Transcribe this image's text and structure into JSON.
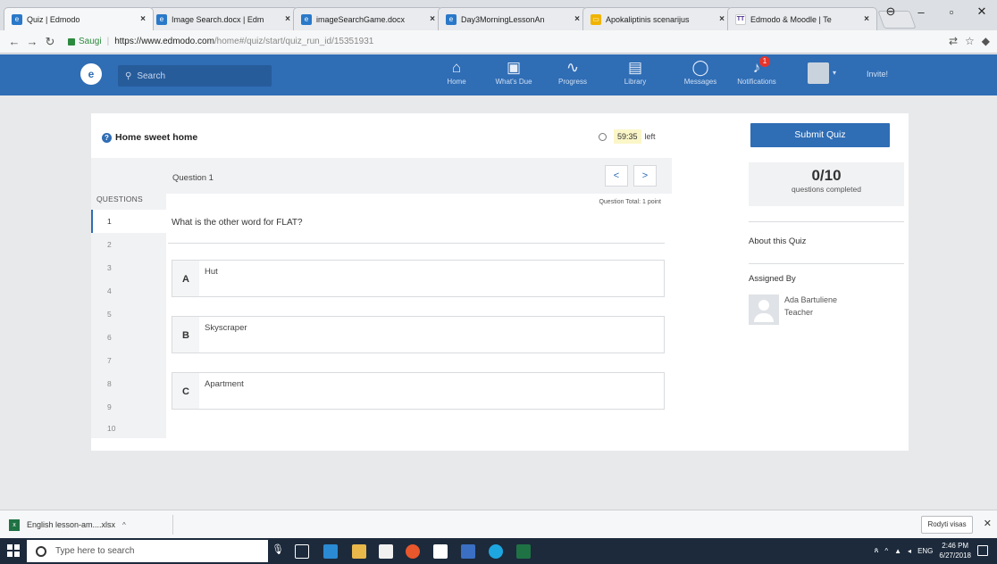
{
  "browser": {
    "tabs": [
      {
        "label": "Quiz | Edmodo",
        "favicon": "edmodo-icon",
        "color": "#2a79c9"
      },
      {
        "label": "Image Search.docx | Edm",
        "favicon": "edmodo-icon",
        "color": "#2a79c9"
      },
      {
        "label": "imageSearchGame.docx",
        "favicon": "edmodo-icon",
        "color": "#2a79c9"
      },
      {
        "label": "Day3MorningLessonAn",
        "favicon": "edmodo-icon",
        "color": "#2a79c9"
      },
      {
        "label": "Apokaliptinis scenarijus",
        "favicon": "slides-icon",
        "color": "#f0b400"
      },
      {
        "label": "Edmodo & Moodle | Te",
        "favicon": "tt-icon",
        "color": "#4a2d8a"
      }
    ],
    "secure_label": "Saugi",
    "url_host": "https://www.edmodo.com",
    "url_path": "/home#/quiz/start/quiz_run_id/15351931"
  },
  "nav": {
    "search_placeholder": "Search",
    "items": [
      {
        "label": "Home",
        "icon": "home-icon"
      },
      {
        "label": "What's Due",
        "icon": "calendar-icon"
      },
      {
        "label": "Progress",
        "icon": "progress-icon"
      },
      {
        "label": "Library",
        "icon": "library-icon"
      },
      {
        "label": "Messages",
        "icon": "messages-icon"
      },
      {
        "label": "Notifications",
        "icon": "bell-icon",
        "badge": "1"
      }
    ],
    "invite_label": "Invite!"
  },
  "quiz": {
    "title": "Home sweet home",
    "time_left": "59:35",
    "time_suffix": "left",
    "question_label": "Question 1",
    "questions_header": "QUESTIONS",
    "question_numbers": [
      "1",
      "2",
      "3",
      "4",
      "5",
      "6",
      "7",
      "8",
      "9",
      "10"
    ],
    "current_question": 1,
    "question_total": "Question Total: 1 point",
    "question_text": "What is the other word for FLAT?",
    "answers": [
      {
        "letter": "A",
        "text": "Hut"
      },
      {
        "letter": "B",
        "text": "Skyscraper"
      },
      {
        "letter": "C",
        "text": "Apartment"
      }
    ]
  },
  "sidebar": {
    "submit_label": "Submit Quiz",
    "completed": "0/10",
    "completed_label": "questions completed",
    "about_label": "About this Quiz",
    "assigned_label": "Assigned By",
    "teacher_name": "Ada Bartuliene",
    "teacher_role": "Teacher"
  },
  "downloads": {
    "file_label": "English lesson-am....xlsx",
    "show_all_label": "Rodyti visas"
  },
  "taskbar": {
    "search_placeholder": "Type here to search",
    "language": "ENG",
    "time": "2:46 PM",
    "date": "6/27/2018"
  },
  "colors": {
    "brand_blue": "#2f6db5",
    "badge_red": "#e5342b",
    "timer_bg": "#fbf6c8"
  }
}
